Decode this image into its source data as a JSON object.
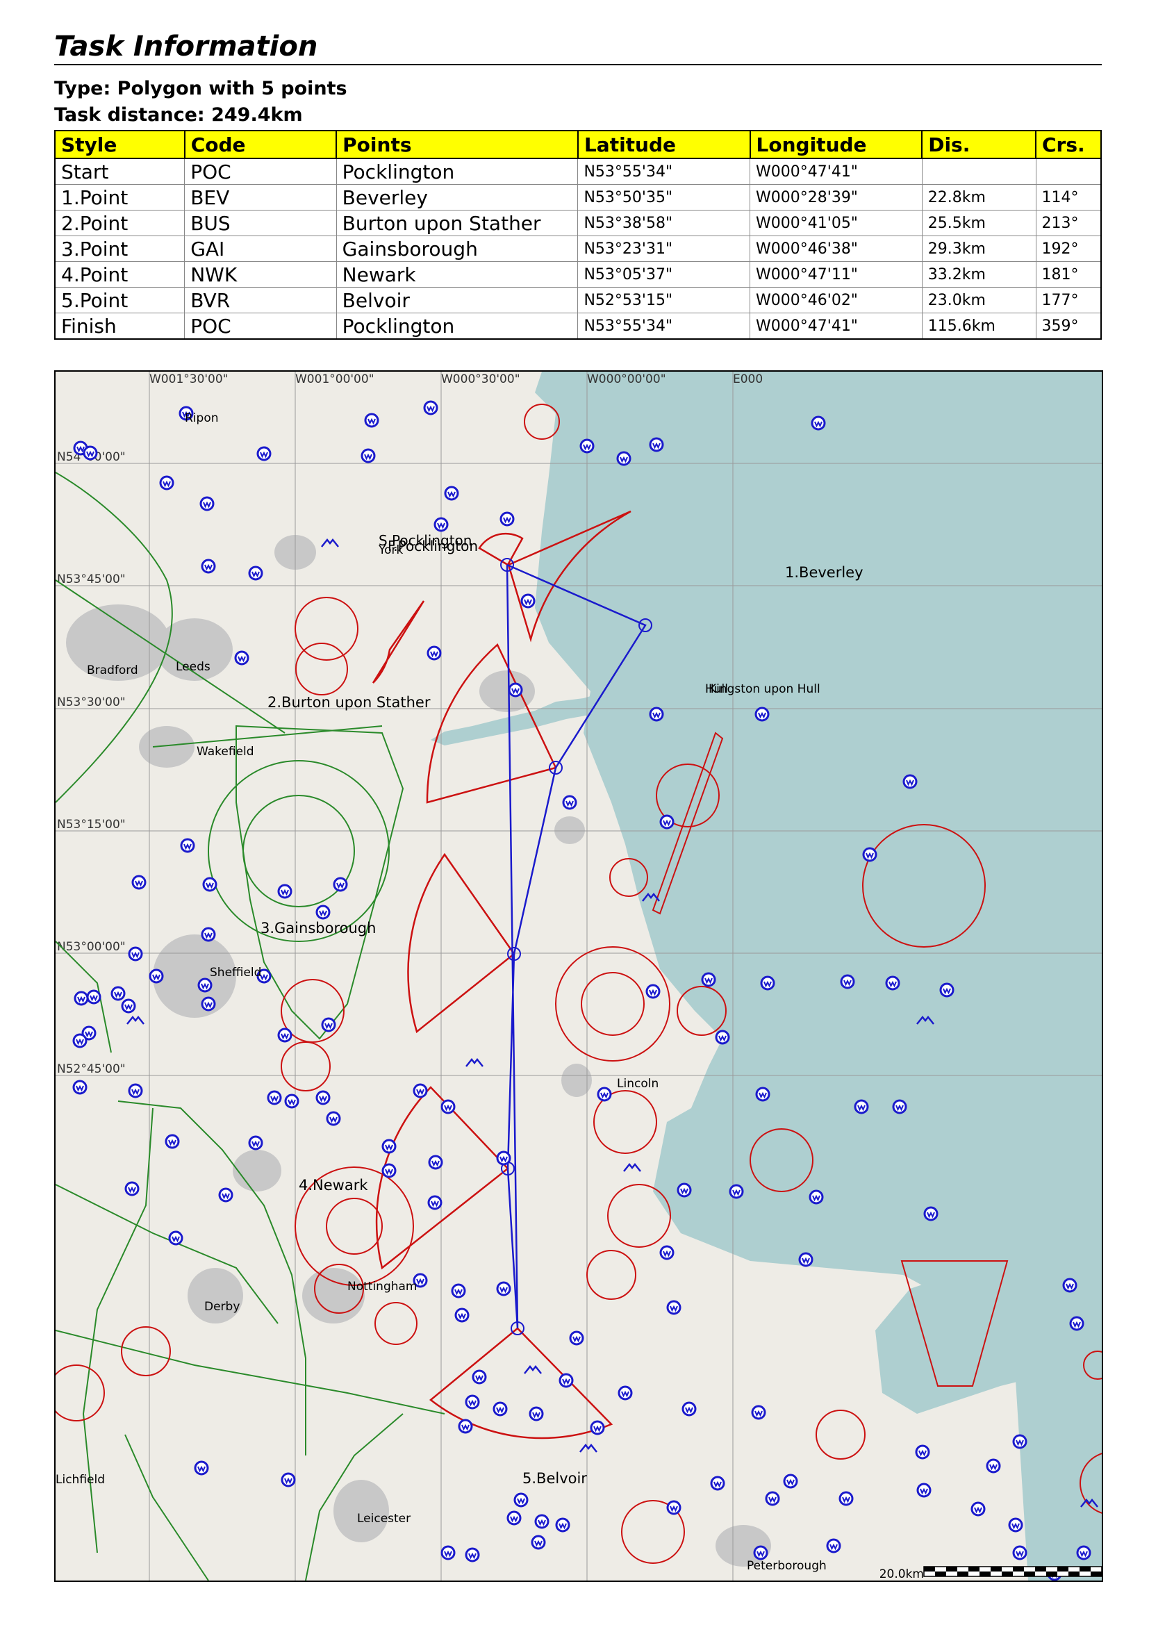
{
  "header": {
    "title": "Task Information",
    "type_line": "Type: Polygon with 5 points",
    "distance_line": "Task distance: 249.4km"
  },
  "table": {
    "columns": [
      "Style",
      "Code",
      "Points",
      "Latitude",
      "Longitude",
      "Dis.",
      "Crs."
    ],
    "rows": [
      [
        "Start",
        "POC",
        "Pocklington",
        "N53°55'34\"",
        "W000°47'41\"",
        "",
        ""
      ],
      [
        "1.Point",
        "BEV",
        "Beverley",
        "N53°50'35\"",
        "W000°28'39\"",
        "22.8km",
        "114°"
      ],
      [
        "2.Point",
        "BUS",
        "Burton upon Stather",
        "N53°38'58\"",
        "W000°41'05\"",
        "25.5km",
        "213°"
      ],
      [
        "3.Point",
        "GAI",
        "Gainsborough",
        "N53°23'31\"",
        "W000°46'38\"",
        "29.3km",
        "192°"
      ],
      [
        "4.Point",
        "NWK",
        "Newark",
        "N53°05'37\"",
        "W000°47'11\"",
        "33.2km",
        "181°"
      ],
      [
        "5.Point",
        "BVR",
        "Belvoir",
        "N52°53'15\"",
        "W000°46'02\"",
        "23.0km",
        "177°"
      ],
      [
        "Finish",
        "POC",
        "Pocklington",
        "N53°55'34\"",
        "W000°47'41\"",
        "115.6km",
        "359°"
      ]
    ]
  },
  "map": {
    "colors": {
      "land": "#eeece6",
      "sea": "#aecfd0",
      "city": "#c8c8c8",
      "task_line": "#1a1acc",
      "sector": "#cc1111",
      "airspace": "#2a8a2a",
      "airfield": "#1a1acc",
      "grid": "#9a9a9a"
    },
    "lon_labels": [
      "W001°30'00\"",
      "W001°00'00\"",
      "W000°30'00\"",
      "W000°00'00\"",
      "E000"
    ],
    "lat_labels": [
      "N54°00'00\"",
      "N53°45'00\"",
      "N53°30'00\"",
      "N53°15'00\"",
      "N53°00'00\"",
      "N52°45'00\""
    ],
    "turnpoint_labels": [
      "S.Pocklington",
      "F.Pocklington",
      "1.Beverley",
      "2.Burton upon Stather",
      "3.Gainsborough",
      "4.Newark",
      "5.Belvoir"
    ],
    "place_labels": [
      "Ripon",
      "York",
      "Leeds",
      "Bradford",
      "Wakefield",
      "Kingston upon Hull",
      "Hull",
      "Sheffield",
      "Lincoln",
      "Nottingham",
      "Derby",
      "Lichfield",
      "Leicester",
      "Peterborough"
    ],
    "scale_label": "20.0km",
    "airfield_icon": "airfield-icon",
    "glider_icon": "glider-site-icon"
  }
}
